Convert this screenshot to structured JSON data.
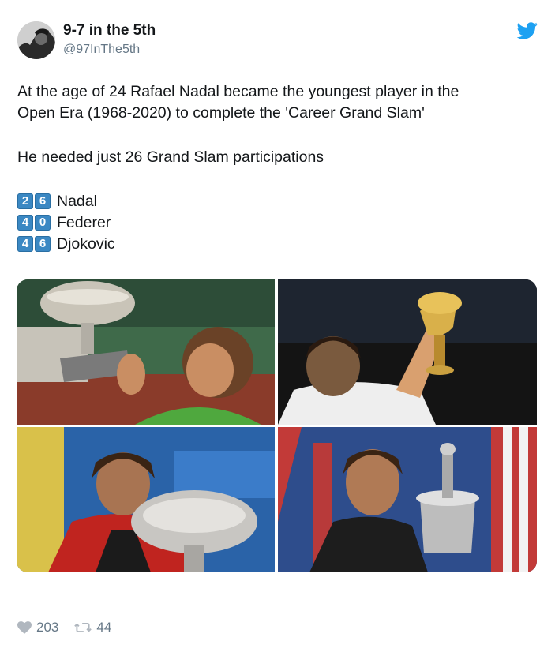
{
  "author": {
    "name": "9-7 in the 5th",
    "handle": "@97InThe5th"
  },
  "tweet": {
    "line1": "At the age of 24 Rafael Nadal became the youngest player in the",
    "line2": "Open Era (1968-2020) to complete the 'Career Grand Slam'",
    "line3": "He needed just 26 Grand Slam participations",
    "stats": [
      {
        "d1": "2",
        "d2": "6",
        "name": "Nadal"
      },
      {
        "d1": "4",
        "d2": "0",
        "name": "Federer"
      },
      {
        "d1": "4",
        "d2": "6",
        "name": "Djokovic"
      }
    ]
  },
  "actions": {
    "likes": "203",
    "retweets": "44"
  },
  "colors": {
    "twitter_blue": "#1da1f2",
    "keycap_blue": "#3b88c3",
    "muted": "#657786"
  },
  "icons": [
    "twitter-bird-icon",
    "heart-icon",
    "retweet-icon"
  ]
}
